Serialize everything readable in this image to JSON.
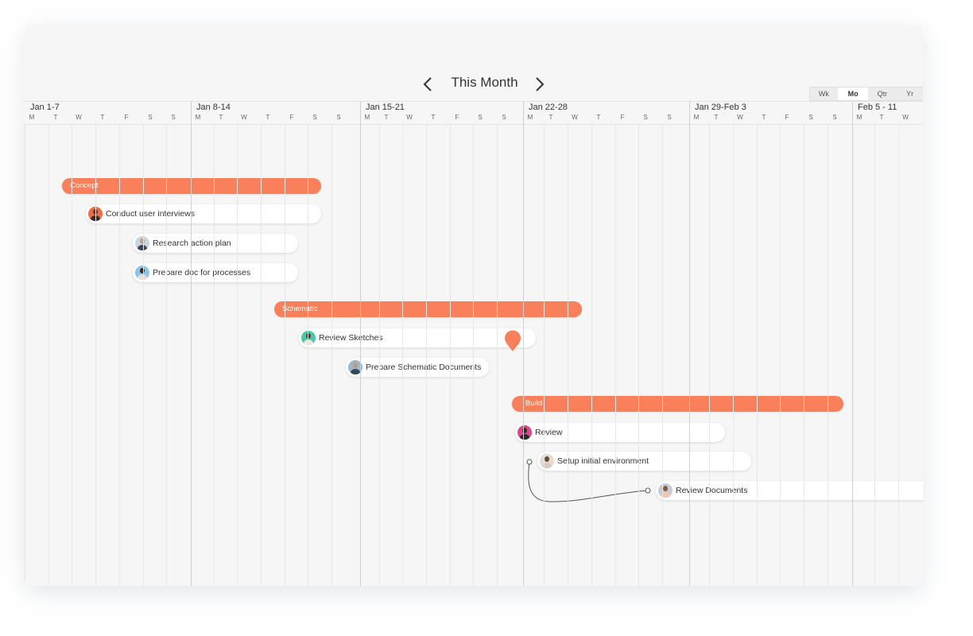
{
  "nav": {
    "title": "This Month",
    "prev_icon": "chevron-left-icon",
    "next_icon": "chevron-right-icon"
  },
  "view_toggle": {
    "options": [
      "Wk",
      "Mo",
      "Qtr",
      "Yr"
    ],
    "selected": "Mo"
  },
  "weeks": [
    "Jan 1-7",
    "Jan 8-14",
    "Jan 15-21",
    "Jan 22-28",
    "Jan 29-Feb 3",
    "Feb 5 - 11"
  ],
  "days": [
    "M",
    "T",
    "W",
    "T",
    "F",
    "S",
    "S",
    "M",
    "T",
    "W",
    "T",
    "F",
    "S",
    "S",
    "M",
    "T",
    "W",
    "T",
    "F",
    "S",
    "S",
    "M",
    "T",
    "W",
    "T",
    "F",
    "S",
    "S",
    "M",
    "T",
    "W",
    "T",
    "F",
    "S",
    "S",
    "M",
    "T",
    "W"
  ],
  "phases": {
    "concept": "Concept",
    "schematic": "Schematic",
    "build": "Build"
  },
  "tasks": {
    "conduct_user_interviews": "Conduct user interviews",
    "research_action_plan": "Research action plan",
    "prepare_doc_for_processes": "Prepare doc for processes",
    "review_sketches": "Review Sketches",
    "prepare_schematic_documents": "Prepare Schematic Documents",
    "review": "Review",
    "setup_initial_environment": "Setup initial environment",
    "review_documents": "Review Documents"
  },
  "colors": {
    "accent": "#f9805a",
    "today_line": "#f28b5c",
    "background": "#f6f6f6"
  }
}
